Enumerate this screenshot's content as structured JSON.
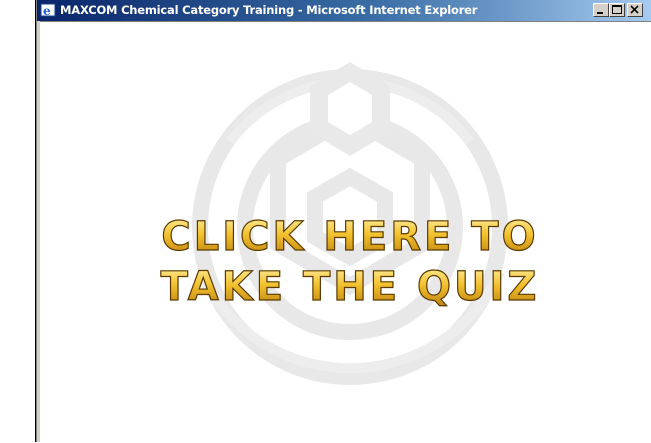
{
  "window": {
    "title": "MAXCOM Chemical Category Training - Microsoft Internet Explorer"
  },
  "controls": {
    "minimize_icon": "minimize-icon",
    "maximize_icon": "maximize-icon",
    "close_icon": "close-icon"
  },
  "content": {
    "quiz_line1": "CLICK HERE TO",
    "quiz_line2": "TAKE THE QUIZ"
  },
  "colors": {
    "titlebar_start": "#0a246a",
    "titlebar_end": "#a6caf0",
    "text_gold": "#f2c12e",
    "watermark": "#e6e6e6"
  }
}
